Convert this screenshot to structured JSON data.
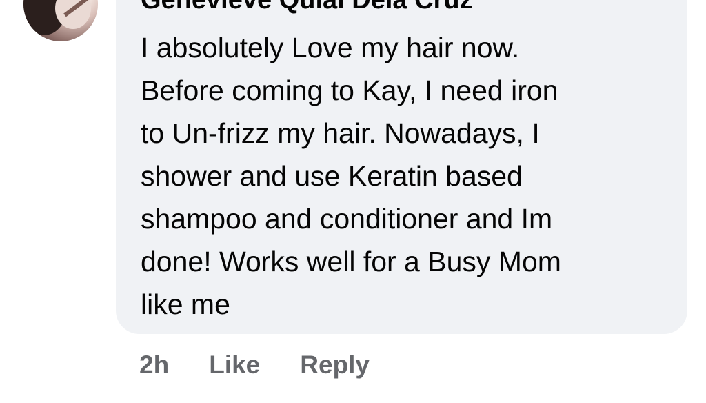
{
  "comment": {
    "author": "Genevieve Quiai Dela Cruz",
    "lines": [
      "I absolutely Love my hair now.",
      "Before coming to Kay, I need iron",
      "to Un-frizz my hair. Nowadays, I",
      "shower and use Keratin based",
      "shampoo and conditioner and Im",
      "done! Works well for a Busy Mom",
      "like me"
    ],
    "timestamp": "2h"
  },
  "actions": {
    "like_label": "Like",
    "reply_label": "Reply"
  },
  "colors": {
    "bubble_bg": "#f0f2f5",
    "text": "#050505",
    "action_text": "#65676b"
  },
  "icons": {
    "avatar": "profile-photo-icon"
  }
}
